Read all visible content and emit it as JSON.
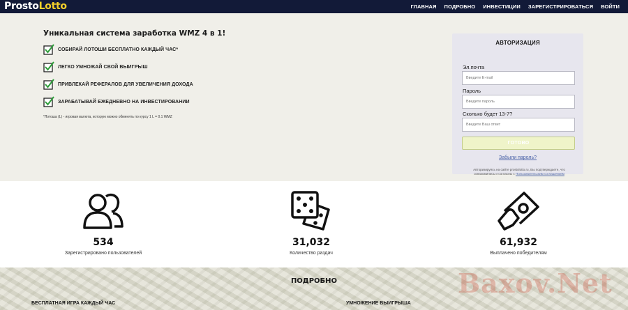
{
  "nav": {
    "logo_part1": "Prosto",
    "logo_part2": "Lotto",
    "items": [
      "ГЛАВНАЯ",
      "ПОДРОБНО",
      "ИНВЕСТИЦИИ",
      "ЗАРЕГИСТРИРОВАТЬСЯ",
      "ВОЙТИ"
    ]
  },
  "hero": {
    "title": "Уникальная система заработка WMZ 4 в 1!",
    "features": [
      "СОБИРАЙ ЛОТОШИ БЕСПЛАТНО КАЖДЫЙ ЧАС*",
      "ЛЕГКО УМНОЖАЙ СВОЙ ВЫИГРЫШ",
      "ПРИВЛЕКАЙ РЕФЕРАЛОВ ДЛЯ УВЕЛИЧЕНИЯ ДОХОДА",
      "ЗАРАБАТЫВАЙ ЕЖЕДНЕВНО НА ИНВЕСТИРОВАНИИ"
    ],
    "footnote": "*Лотоша (L) - игровая валюта, которую можно обменять по курсу 1 L = 0.1 WMZ"
  },
  "auth": {
    "title": "АВТОРИЗАЦИЯ",
    "email_label": "Эл.почта",
    "email_placeholder": "Введите E-mail",
    "password_label": "Пароль",
    "password_placeholder": "Введите пароль",
    "captcha_label": "Сколько будет 13-7?",
    "captcha_placeholder": "Введите Ваш ответ",
    "submit_label": "ГОТОВО",
    "forgot_label": "Забыли пароль?",
    "legal_text": "Авторизируясь на сайте prostolotto.ru, Вы подтверждаете, что ознакомились и согласны с",
    "legal_link": "Пользовательским соглашением"
  },
  "stats": [
    {
      "value": "534",
      "label": "Зарегистрировано пользователей",
      "icon": "users-icon"
    },
    {
      "value": "31,032",
      "label": "Количество раздач",
      "icon": "dice-icon"
    },
    {
      "value": "61,932",
      "label": "Выплачено победителям",
      "icon": "money-hand-icon"
    }
  ],
  "more": {
    "title": "ПОДРОБНО",
    "col1": "БЕСПЛАТНАЯ ИГРА КАЖДЫЙ ЧАС",
    "col2": "УМНОЖЕНИЕ ВЫИГРЫША"
  },
  "watermark": "Baxov.Net",
  "colors": {
    "nav_bg": "#121a38",
    "logo_accent": "#f5d02a",
    "check_green": "#2e9e3a",
    "link": "#4b63a8"
  }
}
